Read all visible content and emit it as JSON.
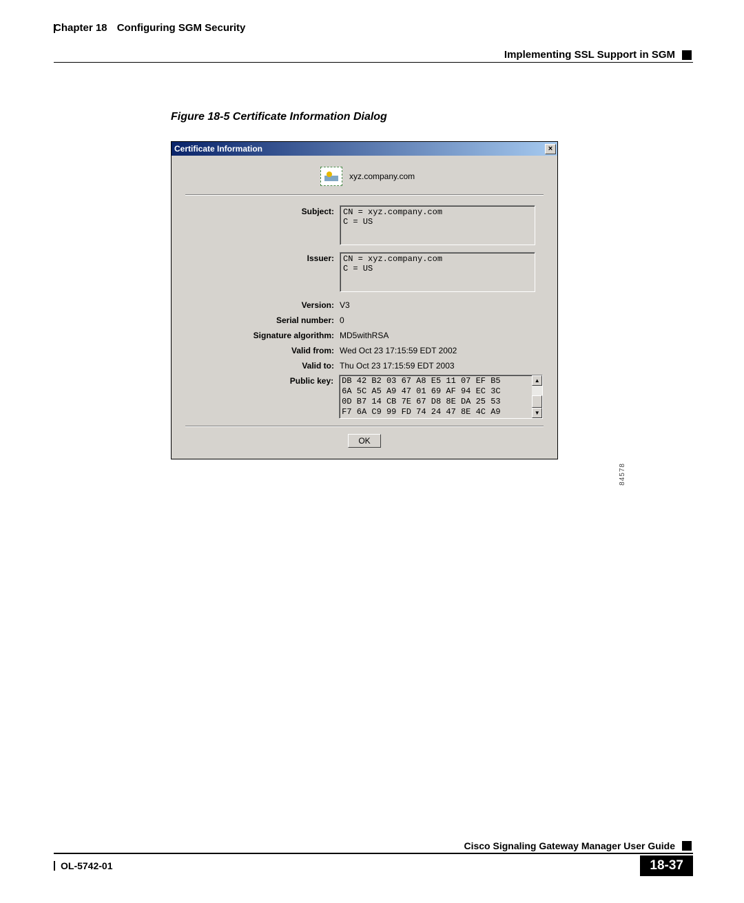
{
  "header": {
    "chapter_num": "Chapter 18",
    "chapter_title": "Configuring SGM Security",
    "section_title": "Implementing SSL Support in SGM"
  },
  "figure": {
    "caption": "Figure 18-5   Certificate Information Dialog",
    "fig_id": "84578"
  },
  "dialog": {
    "title": "Certificate Information",
    "close_glyph": "×",
    "host": "xyz.company.com",
    "labels": {
      "subject": "Subject:",
      "issuer": "Issuer:",
      "version": "Version:",
      "serial": "Serial number:",
      "sigalg": "Signature algorithm:",
      "valid_from": "Valid from:",
      "valid_to": "Valid to:",
      "public_key": "Public key:"
    },
    "values": {
      "subject": "CN = xyz.company.com\nC = US",
      "issuer": "CN = xyz.company.com\nC = US",
      "version": "V3",
      "serial": "0",
      "sigalg": "MD5withRSA",
      "valid_from": "Wed Oct 23 17:15:59 EDT 2002",
      "valid_to": "Thu Oct 23 17:15:59 EDT 2003",
      "public_key": "DB 42 B2 03 67 A8 E5 11 07 EF B5\n6A 5C A5 A9 47 01 69 AF 94 EC 3C\n0D B7 14 CB 7E 67 D8 8E DA 25 53\nF7 6A C9 99 FD 74 24 47 8E 4C A9"
    },
    "scroll_up": "▲",
    "scroll_down": "▼",
    "ok_label": "OK"
  },
  "footer": {
    "guide": "Cisco Signaling Gateway Manager User Guide",
    "doc_id": "OL-5742-01",
    "page_num": "18-37"
  }
}
